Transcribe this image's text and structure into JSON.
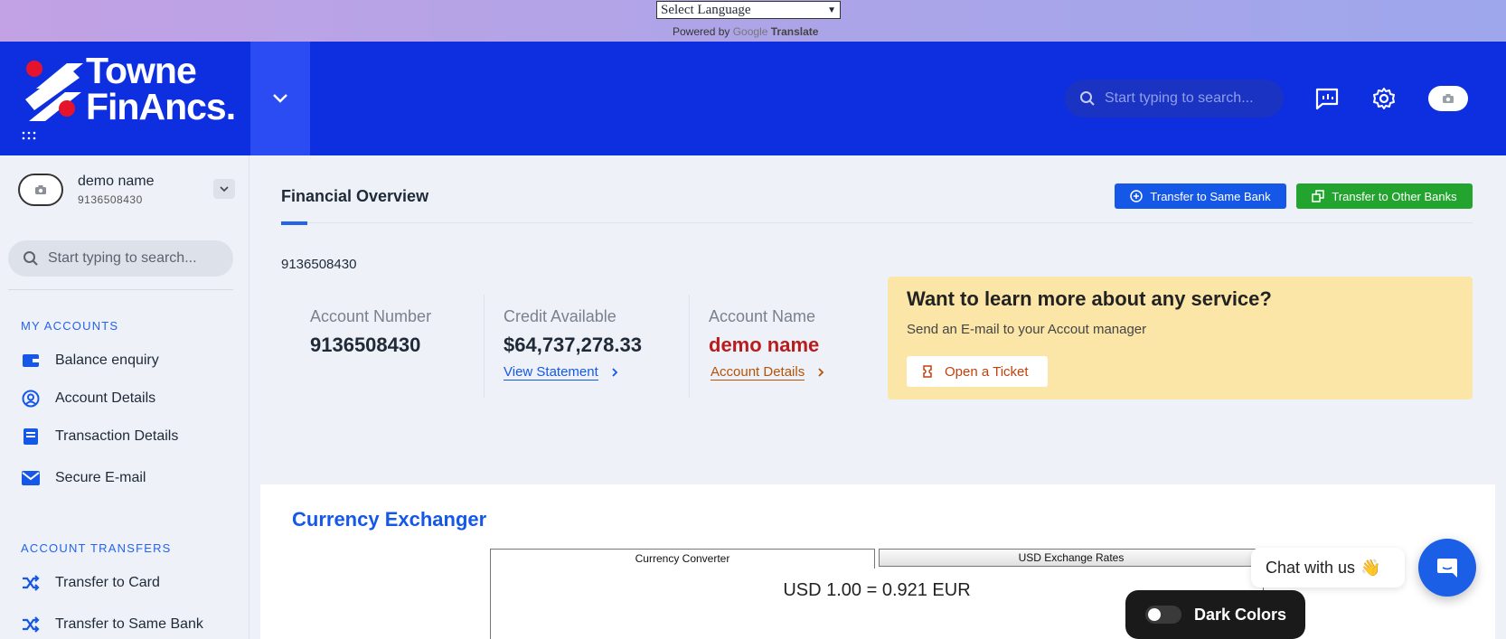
{
  "translate": {
    "select_label": "Select Language",
    "powered_by": "Powered by",
    "google": "Google",
    "translate": "Translate"
  },
  "header": {
    "logo_line1": "Towne",
    "logo_line2": "FinAncs.",
    "search_placeholder": "Start typing to search..."
  },
  "sidebar": {
    "user_name": "demo name",
    "user_number": "9136508430",
    "search_placeholder": "Start typing to search...",
    "section_accounts": "MY ACCOUNTS",
    "accounts_items": [
      {
        "label": "Balance enquiry",
        "icon": "wallet-icon"
      },
      {
        "label": "Account Details",
        "icon": "user-circle-icon"
      },
      {
        "label": "Transaction Details",
        "icon": "book-icon"
      },
      {
        "label": "Secure E-mail",
        "icon": "mail-icon"
      }
    ],
    "section_transfers": "ACCOUNT TRANSFERS",
    "transfer_items": [
      {
        "label": "Transfer to Card",
        "icon": "shuffle-icon"
      },
      {
        "label": "Transfer to Same Bank",
        "icon": "shuffle-icon"
      }
    ]
  },
  "main": {
    "title": "Financial Overview",
    "btn_same_bank": "Transfer to Same Bank",
    "btn_other_banks": "Transfer to Other Banks",
    "account_line": "9136508430",
    "stats": {
      "account_number_label": "Account Number",
      "account_number_value": "9136508430",
      "credit_label": "Credit Available",
      "credit_value": "$64,737,278.33",
      "view_statement": "View Statement",
      "account_name_label": "Account Name",
      "account_name_value": "demo name",
      "account_details": "Account Details"
    },
    "promo": {
      "heading": "Want to learn more about any service?",
      "sub": "Send an E-mail to your Accout manager",
      "button": "Open a Ticket"
    }
  },
  "currency": {
    "title": "Currency Exchanger",
    "tab_converter": "Currency Converter",
    "tab_rates": "USD Exchange Rates",
    "conversion": "USD 1.00 = 0.921 EUR"
  },
  "widgets": {
    "chat_label": "Chat with us",
    "chat_emoji": "👋",
    "dark_label": "Dark Colors"
  },
  "colors": {
    "header_bg": "#0d2fe0",
    "accent_blue": "#1558e8",
    "accent_green": "#22a42f",
    "name_red": "#b91c1c",
    "promo_bg": "#fbe6a8"
  }
}
